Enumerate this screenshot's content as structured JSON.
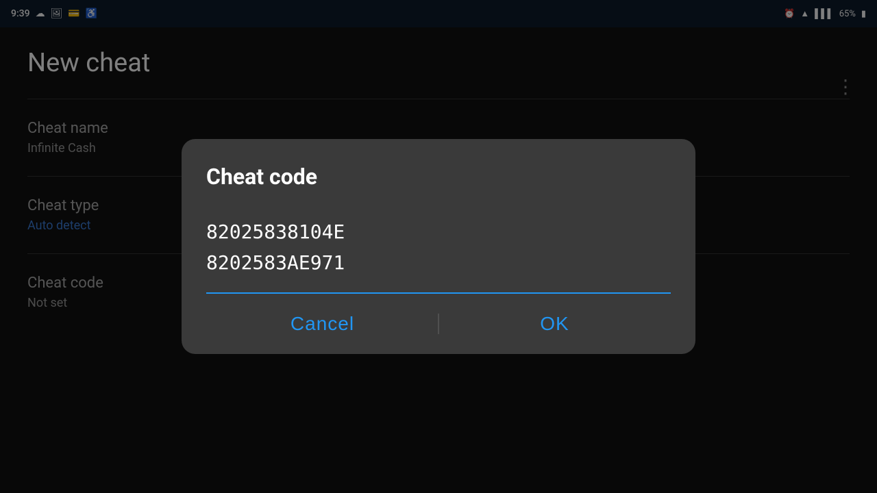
{
  "statusBar": {
    "time": "9:39",
    "battery": "65%",
    "icons": {
      "alarm": "⏰",
      "sync": "☁",
      "gallery": "🖼",
      "nfc": "💳",
      "accessibility": "♿",
      "wifi": "WiFi",
      "signal": "▌▌▌",
      "battery_icon": "🔋"
    }
  },
  "page": {
    "title": "New cheat",
    "more_icon": "⋮",
    "sections": [
      {
        "label": "Cheat name",
        "value": "Infinite Cash",
        "value_color": "normal"
      },
      {
        "label": "Cheat type",
        "value": "Auto detect",
        "value_color": "blue"
      },
      {
        "label": "Cheat code",
        "value": "Not set",
        "value_color": "normal"
      }
    ]
  },
  "dialog": {
    "title": "Cheat code",
    "code_line1": "82025838104E",
    "code_line2": "8202583AE971",
    "cancel_label": "Cancel",
    "ok_label": "OK"
  }
}
